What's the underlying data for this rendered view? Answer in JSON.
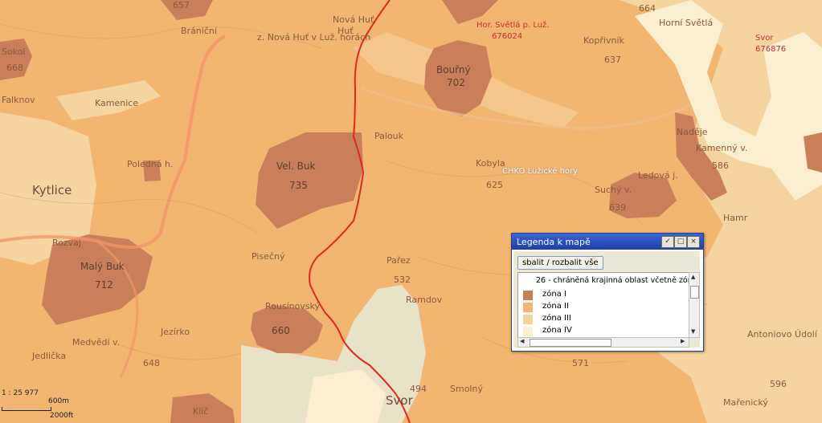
{
  "map": {
    "colors": {
      "zone1": "#c9805a",
      "zone2": "#f2b572",
      "zone3": "#f6d4a0",
      "zone4": "#fbefcf",
      "urban": "#e7e2c8",
      "boundary": "#e0281e",
      "road": "#f2956a"
    },
    "places": [
      {
        "name": "Kytlice"
      },
      {
        "name": "Nová Huť",
        "sub": "Huť"
      },
      {
        "name": "z. Nová Huť v Luž. horách"
      },
      {
        "name": "Brániční"
      },
      {
        "name": "Sokol"
      },
      {
        "name": "Falknov"
      },
      {
        "name": "Kamenice"
      },
      {
        "name": "Rozvaj"
      },
      {
        "name": "Medvědí v."
      },
      {
        "name": "Jedlička"
      },
      {
        "name": "Jezírko"
      },
      {
        "name": "Pisečný"
      },
      {
        "name": "Palouk"
      },
      {
        "name": "Pařez"
      },
      {
        "name": "Kobyla"
      },
      {
        "name": "Suchý v."
      },
      {
        "name": "Ledová j."
      },
      {
        "name": "Kamenný v."
      },
      {
        "name": "Hamr"
      },
      {
        "name": "Kopřivník"
      },
      {
        "name": "Horní Světlá"
      },
      {
        "name": "Svor"
      },
      {
        "name": "Smolný"
      },
      {
        "name": "Antoniovo Údolí"
      },
      {
        "name": "Mařenický"
      },
      {
        "name": "Klíč"
      },
      {
        "name": "Rousínovský"
      },
      {
        "name": "Poledná h."
      },
      {
        "name": "Ramdov"
      },
      {
        "name": "Naděje"
      }
    ],
    "peaks": [
      {
        "name": "Bouřný",
        "elev": "702"
      },
      {
        "name": "Vel. Buk",
        "elev": "735"
      },
      {
        "name": "Malý Buk",
        "elev": "712"
      },
      {
        "name": "Rousínovský",
        "elev": "660"
      },
      {
        "name": "657",
        "elev": ""
      },
      {
        "name": "664",
        "elev": ""
      },
      {
        "name": "637",
        "elev": ""
      },
      {
        "name": "625",
        "elev": ""
      },
      {
        "name": "639",
        "elev": ""
      },
      {
        "name": "586",
        "elev": ""
      },
      {
        "name": "668",
        "elev": ""
      },
      {
        "name": "648",
        "elev": ""
      },
      {
        "name": "532",
        "elev": ""
      },
      {
        "name": "571",
        "elev": ""
      },
      {
        "name": "596",
        "elev": ""
      },
      {
        "name": "494",
        "elev": ""
      }
    ],
    "area_label": "CHKO Lužické hory",
    "red_labels": [
      "Hor. Světlá p. Luž.",
      "676024",
      "Svor",
      "676876"
    ],
    "scale": {
      "ratio": "1 : 25 977",
      "metric": "600m",
      "imperial": "2000ft"
    }
  },
  "legend": {
    "title": "Legenda k mapě",
    "toggle_label": "sbalit / rozbalit vše",
    "header": "26 - chráněná krajinná oblast včetně zón",
    "items": [
      {
        "label": "zóna I",
        "color": "#c9805a"
      },
      {
        "label": "zóna II",
        "color": "#f2b572"
      },
      {
        "label": "zóna III",
        "color": "#f6d4a0"
      },
      {
        "label": "zóna IV",
        "color": "#fbefcf"
      }
    ],
    "buttons": {
      "minimize": "✓",
      "maximize": "□",
      "close": "×"
    }
  }
}
